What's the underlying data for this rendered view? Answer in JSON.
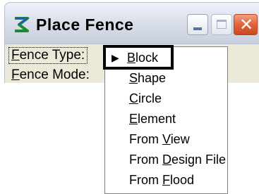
{
  "window": {
    "title": "Place Fence",
    "icon": "fence-app-icon",
    "controls": {
      "minimize_icon": "minimize-icon",
      "maximize_icon": "maximize-icon",
      "close_icon": "close-icon",
      "close_color": "#e1633a"
    }
  },
  "form": {
    "fence_type_label": {
      "underlined": "F",
      "rest": "ence Type:"
    },
    "fence_mode_label": {
      "underlined": "F",
      "rest": "ence Mode:"
    }
  },
  "dropdown": {
    "arrow_icon": "arrow-right-icon",
    "items": [
      {
        "pre": "",
        "underlined": "B",
        "post": "lock",
        "selected": true
      },
      {
        "pre": "",
        "underlined": "S",
        "post": "hape"
      },
      {
        "pre": "",
        "underlined": "C",
        "post": "ircle"
      },
      {
        "pre": "",
        "underlined": "E",
        "post": "lement"
      },
      {
        "pre": "From ",
        "underlined": "V",
        "post": "iew"
      },
      {
        "pre": "From ",
        "underlined": "D",
        "post": "esign File"
      },
      {
        "pre": "From ",
        "underlined": "F",
        "post": "lood"
      }
    ]
  }
}
